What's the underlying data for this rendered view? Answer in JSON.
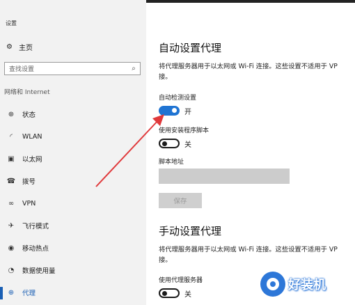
{
  "window": {
    "title": "设置"
  },
  "sidebar": {
    "home": "主页",
    "search_placeholder": "查找设置",
    "section": "网络和 Internet",
    "items": [
      {
        "label": "状态",
        "icon": "globe-icon"
      },
      {
        "label": "WLAN",
        "icon": "wifi-icon"
      },
      {
        "label": "以太网",
        "icon": "ethernet-icon"
      },
      {
        "label": "拨号",
        "icon": "phone-icon"
      },
      {
        "label": "VPN",
        "icon": "vpn-icon"
      },
      {
        "label": "飞行模式",
        "icon": "airplane-icon"
      },
      {
        "label": "移动热点",
        "icon": "hotspot-icon"
      },
      {
        "label": "数据使用量",
        "icon": "data-usage-icon"
      },
      {
        "label": "代理",
        "icon": "globe-icon",
        "active": true
      }
    ]
  },
  "auto_proxy": {
    "title": "自动设置代理",
    "description_line1": "将代理服务器用于以太网或 Wi-Fi 连接。这些设置不适用于 VP",
    "description_line2": "接。",
    "auto_detect_label": "自动检测设置",
    "auto_detect_state": "开",
    "script_label": "使用安装程序脚本",
    "script_state": "关",
    "address_label": "脚本地址",
    "save_label": "保存"
  },
  "manual_proxy": {
    "title": "手动设置代理",
    "description_line1": "将代理服务器用于以太网或 Wi-Fi 连接。这些设置不适用于 VP",
    "description_line2": "接。",
    "use_proxy_label": "使用代理服务器",
    "use_proxy_state": "关"
  },
  "watermark": {
    "text": "好装机"
  },
  "colors": {
    "accent": "#1f74d3",
    "arrow": "#e0393b",
    "sidebar_bg": "#f2f2f2"
  }
}
